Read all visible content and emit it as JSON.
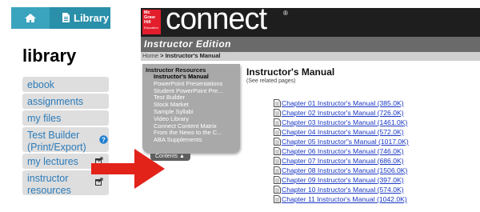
{
  "sidebar": {
    "tabs": {
      "home_icon": "home-icon",
      "library_icon": "document-icon",
      "library_label": "Library"
    },
    "title": "library",
    "items": [
      {
        "label": "ebook",
        "external": false
      },
      {
        "label": "assignments",
        "external": false
      },
      {
        "label": "my files",
        "external": false
      },
      {
        "label": "Test Builder\n(Print/Export)",
        "external": false,
        "help": true
      },
      {
        "label": "my lectures",
        "external": true
      },
      {
        "label": "instructor\nresources",
        "external": true
      }
    ]
  },
  "connect": {
    "logo_text": [
      "Mc",
      "Graw",
      "Hill",
      "Education"
    ],
    "brand": "connect",
    "registered_mark": "®",
    "edition": "Instructor Edition",
    "breadcrumb": {
      "home": "Home",
      "separator": ">",
      "current": "Instructor's Manual"
    },
    "menu": {
      "heading": "Instructor Resources",
      "items": [
        {
          "label": "Instructor's Manual",
          "active": true
        },
        {
          "label": "PowerPoint Presentations",
          "active": false
        },
        {
          "label": "Student PowerPoint Pre...",
          "active": false
        },
        {
          "label": "Test Builder",
          "active": false
        },
        {
          "label": "Stock Market",
          "active": false
        },
        {
          "label": "Sample Syllabi",
          "active": false
        },
        {
          "label": "Video Library",
          "active": false
        },
        {
          "label": "Connect Content Matrix",
          "active": false
        },
        {
          "label": "From the News to the C...",
          "active": false
        },
        {
          "label": "ABA Supplements",
          "active": false
        }
      ],
      "toggle_label": "Contents ▲"
    },
    "page_title": "Instructor's Manual",
    "page_subtitle": "(See related pages)",
    "chapters": [
      "Chapter 01 Instructor's Manual (385.0K)",
      "Chapter 02 Instructor's Manual (726.0K)",
      "Chapter 03 Instructor's Manual (1461.0K)",
      "Chapter 04 Instructor's Manual (572.0K)",
      "Chapter 05 Instructor\"s Manual (1017.0K)",
      "Chapter 06 Instructor's Manual (746.0K)",
      "Chapter 07 Instructor's Manual (686.0K)",
      "Chapter 08 Instructor's Manual (1506.0K)",
      "Chapter 09 Instructor's Manual (397.0K)",
      "Chapter 10 Instructor's Manual (574.0K)",
      "Chapter 11 Instructor's Manual (1042.0K)"
    ]
  },
  "colors": {
    "tab_home": "#3aa3bd",
    "tab_library": "#2a8fa9",
    "sidebar_link": "#2b7bb9",
    "help_badge": "#1e7fd0",
    "arrow": "#e2231a",
    "mh_red": "#e21d2c",
    "chapter_link": "#1a37c4"
  },
  "annotation": {
    "arrow_icon": "red-arrow-icon"
  }
}
